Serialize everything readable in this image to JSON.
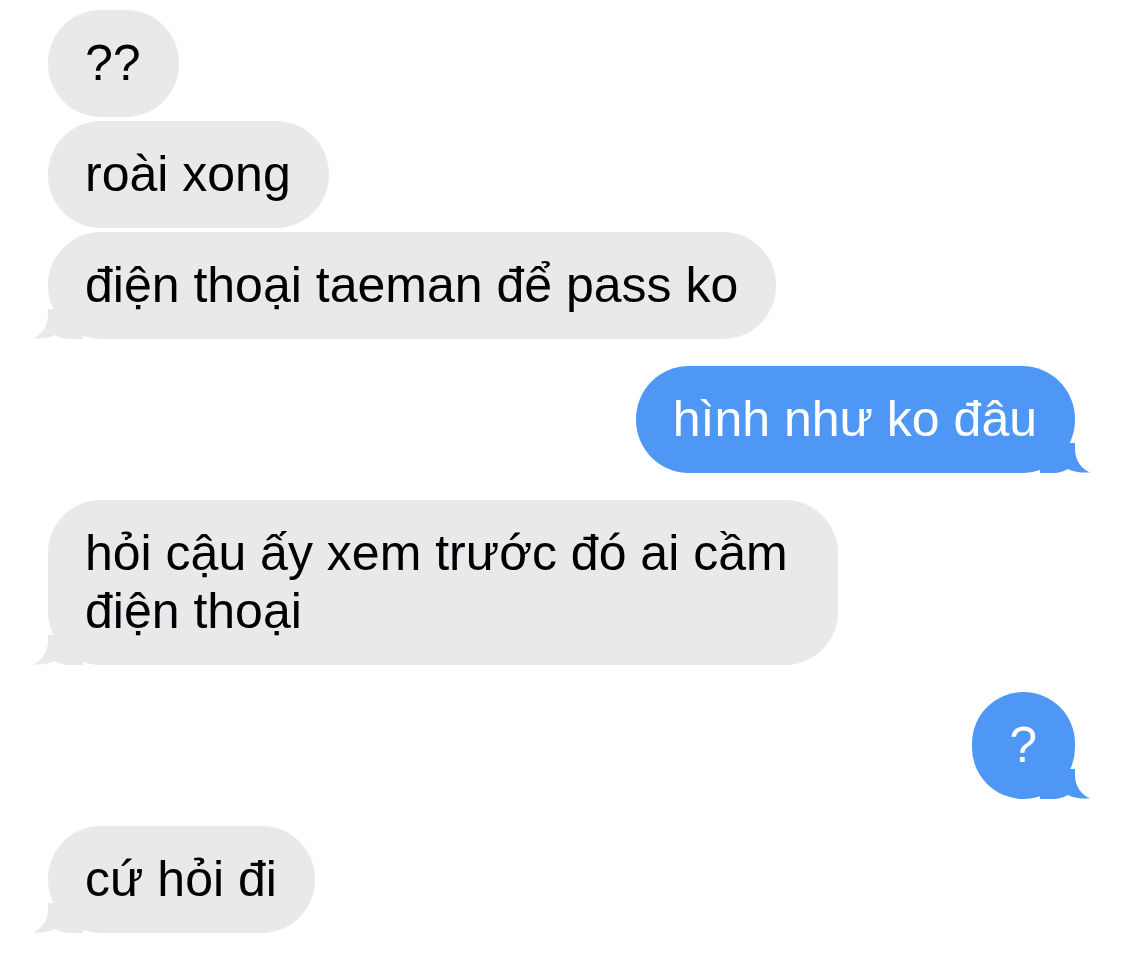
{
  "messages": [
    {
      "kind": "incoming",
      "text": "??",
      "tail": false
    },
    {
      "kind": "incoming",
      "text": "roài xong",
      "tail": false
    },
    {
      "kind": "incoming",
      "text": "điện thoại taeman để pass ko",
      "tail": true
    },
    {
      "kind": "outgoing",
      "text": "hình như ko đâu",
      "tail": true
    },
    {
      "kind": "incoming",
      "text": "hỏi cậu ấy xem trước đó ai cầm điện thoại",
      "tail": true
    },
    {
      "kind": "outgoing",
      "text": "?",
      "tail": true
    },
    {
      "kind": "incoming",
      "text": "cứ hỏi đi",
      "tail": true
    }
  ]
}
